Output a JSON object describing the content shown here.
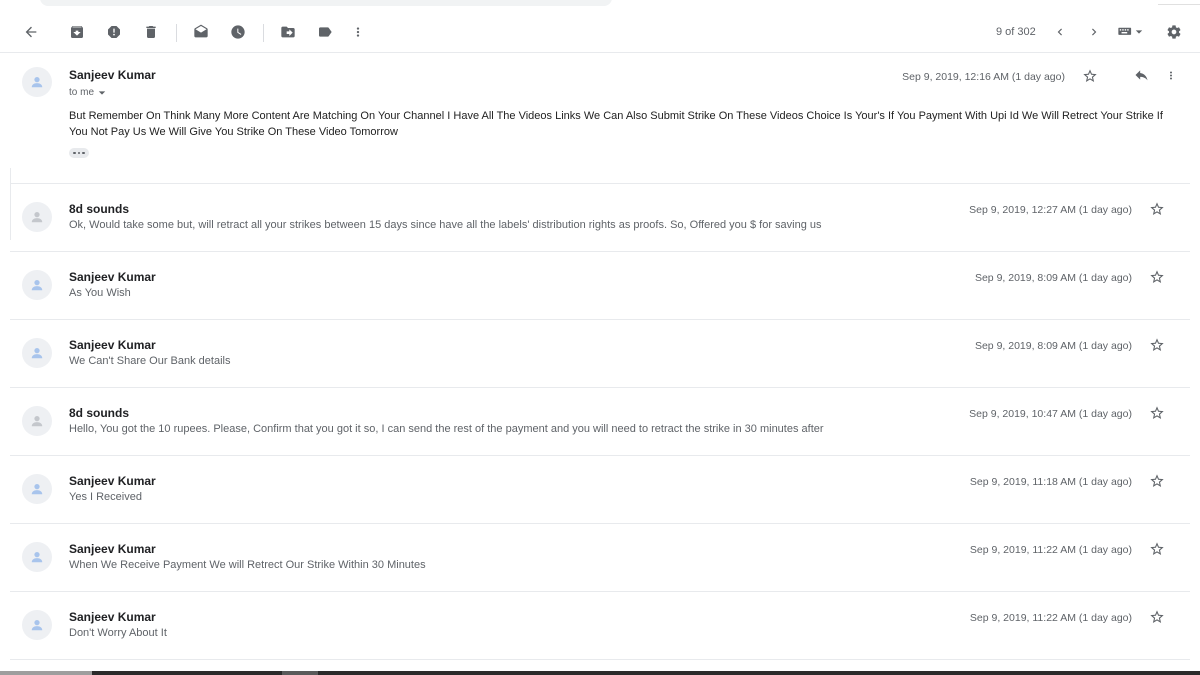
{
  "toolbar": {
    "back": "arrow-back-icon",
    "archive": "archive-icon",
    "spam": "report-spam-icon",
    "delete": "delete-icon",
    "unread": "mark-unread-icon",
    "snooze": "snooze-icon",
    "move": "move-to-icon",
    "labels": "label-icon",
    "more": "more-vert-icon",
    "pager": "9 of 302",
    "settings": "gear-icon"
  },
  "first_message": {
    "sender": "Sanjeev Kumar",
    "to": "to me",
    "date": "Sep 9, 2019, 12:16 AM (1 day ago)",
    "body": "But Remember On Think Many More Content Are Matching On Your Channel I Have All The Videos Links We Can Also Submit Strike On These Videos Choice Is Your's If You Payment With Upi Id We Will Retrect Your Strike If You Not Pay Us We Will Give You Strike On These Video Tomorrow"
  },
  "messages": [
    {
      "sender": "8d sounds",
      "snippet": "Ok, Would take some but, will retract all your strikes between 15 days since have all the labels' distribution rights as proofs. So, Offered you $ for saving us",
      "date": "Sep 9, 2019, 12:27 AM (1 day ago)"
    },
    {
      "sender": "Sanjeev Kumar",
      "snippet": "As You Wish",
      "date": "Sep 9, 2019, 8:09 AM (1 day ago)"
    },
    {
      "sender": "Sanjeev Kumar",
      "snippet": "We Can't Share Our Bank details",
      "date": "Sep 9, 2019, 8:09 AM (1 day ago)"
    },
    {
      "sender": "8d sounds",
      "snippet": "Hello, You got the 10 rupees. Please, Confirm that you got it so, I can send the rest of the payment and you will need to retract the strike in 30 minutes after",
      "date": "Sep 9, 2019, 10:47 AM (1 day ago)"
    },
    {
      "sender": "Sanjeev Kumar",
      "snippet": "Yes I Received",
      "date": "Sep 9, 2019, 11:18 AM (1 day ago)"
    },
    {
      "sender": "Sanjeev Kumar",
      "snippet": "When We Receive Payment We will Retrect Our Strike Within 30 Minutes",
      "date": "Sep 9, 2019, 11:22 AM (1 day ago)"
    },
    {
      "sender": "Sanjeev Kumar",
      "snippet": "Don't Worry About It",
      "date": "Sep 9, 2019, 11:22 AM (1 day ago)"
    }
  ]
}
